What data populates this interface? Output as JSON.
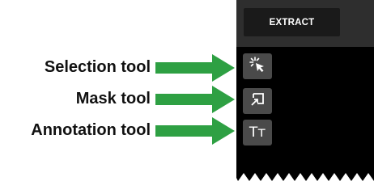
{
  "toolbar": {
    "extract_label": "EXTRACT"
  },
  "tools": [
    {
      "label": "Selection tool",
      "icon": "cursor-sparkle-icon"
    },
    {
      "label": "Mask tool",
      "icon": "mask-arrow-box-icon"
    },
    {
      "label": "Annotation tool",
      "icon": "text-tt-icon",
      "glyph": "Tт"
    }
  ],
  "colors": {
    "panel": "#000000",
    "toolbar": "#2e2e2e",
    "button": "#1a1a1a",
    "tool_button": "#4a4a4a",
    "arrow": "#2ea043"
  }
}
